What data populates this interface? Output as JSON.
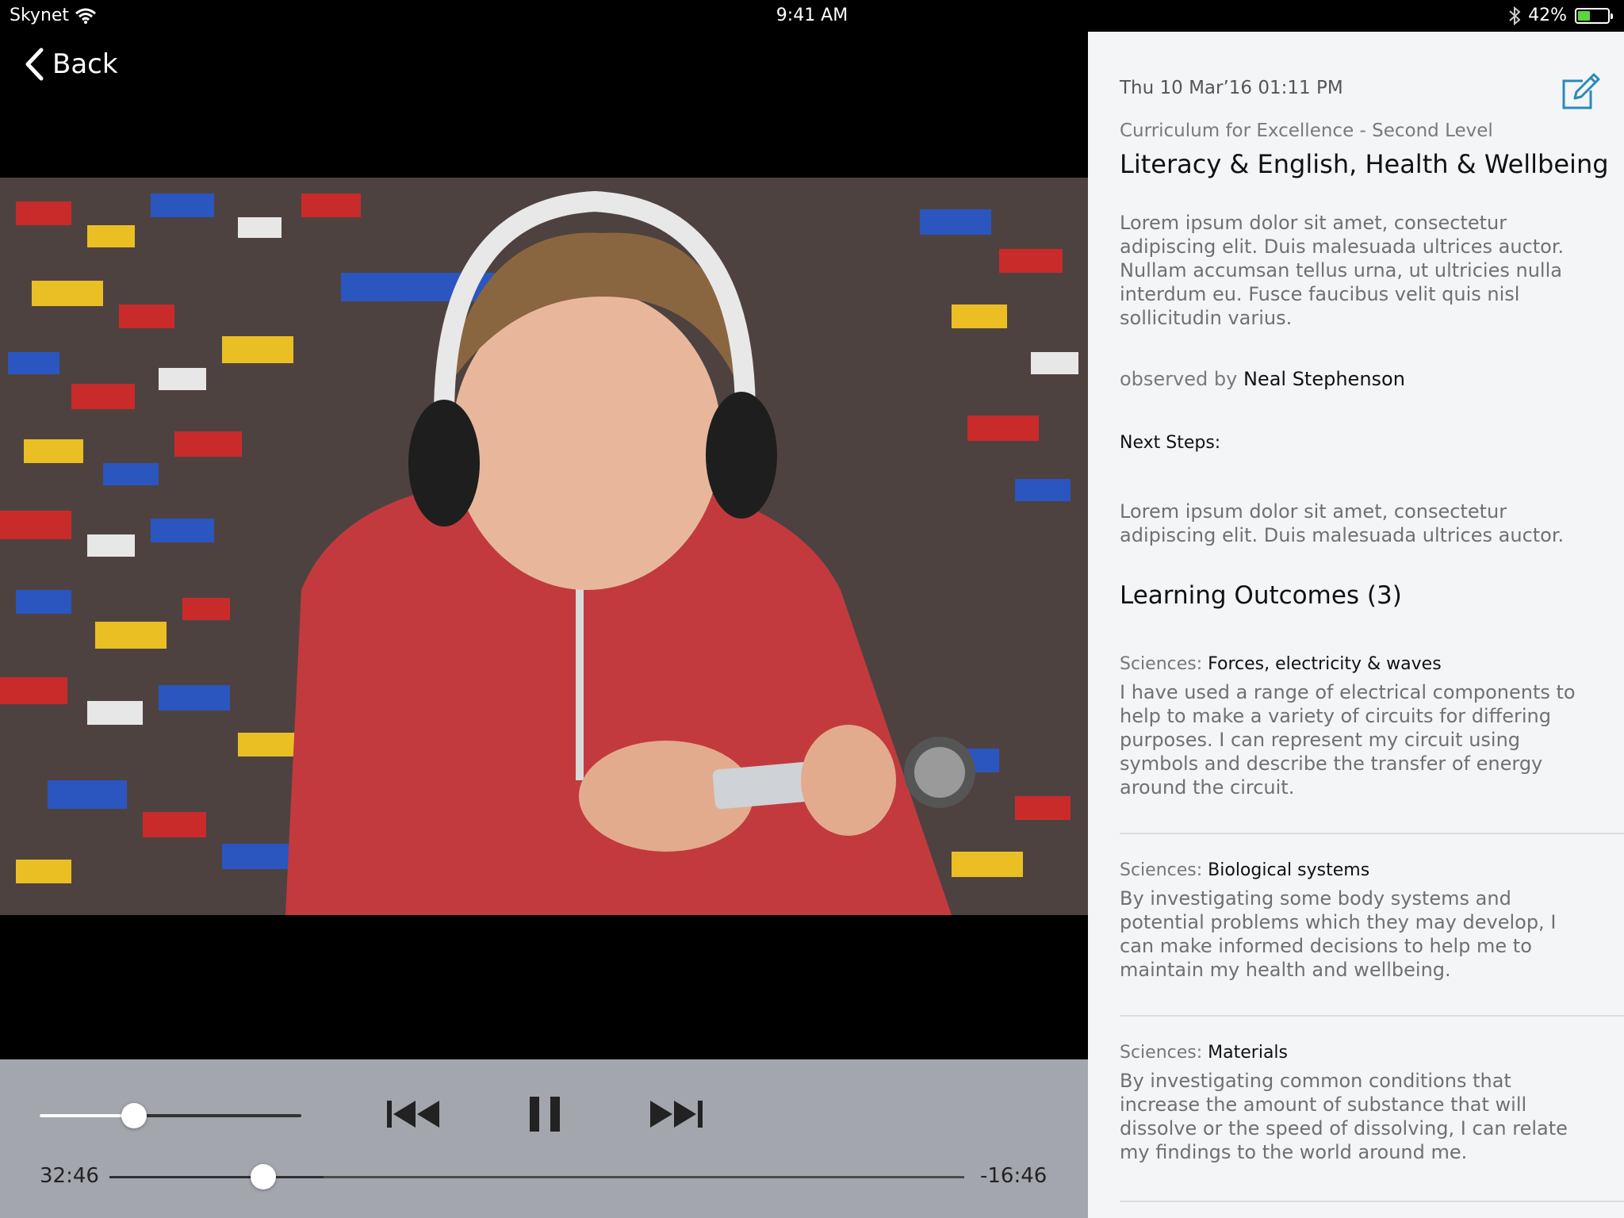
{
  "status_bar": {
    "carrier": "Skynet",
    "time": "9:41 AM",
    "battery_percent": "42%",
    "battery_level": 0.42,
    "icons": [
      "wifi-icon",
      "bluetooth-icon",
      "battery-icon"
    ]
  },
  "nav": {
    "back_label": "Back"
  },
  "player": {
    "elapsed": "32:46",
    "remaining": "-16:46",
    "progress": 0.18,
    "buffered": 0.25,
    "volume": 0.36,
    "controls": [
      "previous-icon",
      "pause-icon",
      "next-icon"
    ]
  },
  "details": {
    "timestamp": "Thu 10 Mar’16 01:11 PM",
    "curriculum": "Curriculum for Excellence - Second Level",
    "title": "Literacy & English, Health & Wellbeing",
    "description": "Lorem ipsum dolor sit amet, consectetur adipiscing elit. Duis malesuada ultrices auctor. Nullam accumsan tellus urna, ut ultricies nulla interdum eu. Fusce faucibus velit quis nisl sollicitudin varius.",
    "observed_prefix": "observed by",
    "observer": "Neal Stephenson",
    "next_steps_label": "Next Steps:",
    "next_steps_text": "Lorem ipsum dolor sit amet, consectetur adipiscing elit. Duis malesuada ultrices auctor.",
    "outcomes_title": "Learning Outcomes (3)",
    "outcomes": [
      {
        "subject": "Sciences:",
        "topic": "Forces, electricity & waves",
        "text": "I have used a range of electrical components to help to make a variety of circuits for differing purposes. I can represent my circuit using symbols and describe the transfer of energy around the circuit."
      },
      {
        "subject": "Sciences:",
        "topic": "Biological systems",
        "text": "By investigating some body systems and potential problems which they may develop, I can make informed decisions to help me to maintain my health and wellbeing."
      },
      {
        "subject": "Sciences:",
        "topic": "Materials",
        "text": "By investigating common conditions that increase the amount of substance that will dissolve or the speed of dissolving, I can relate my findings to the world around me."
      }
    ]
  },
  "colors": {
    "accent": "#2a8ab8",
    "panel_bg": "#f4f5f7",
    "controls_bg": "#a3a6ad"
  }
}
